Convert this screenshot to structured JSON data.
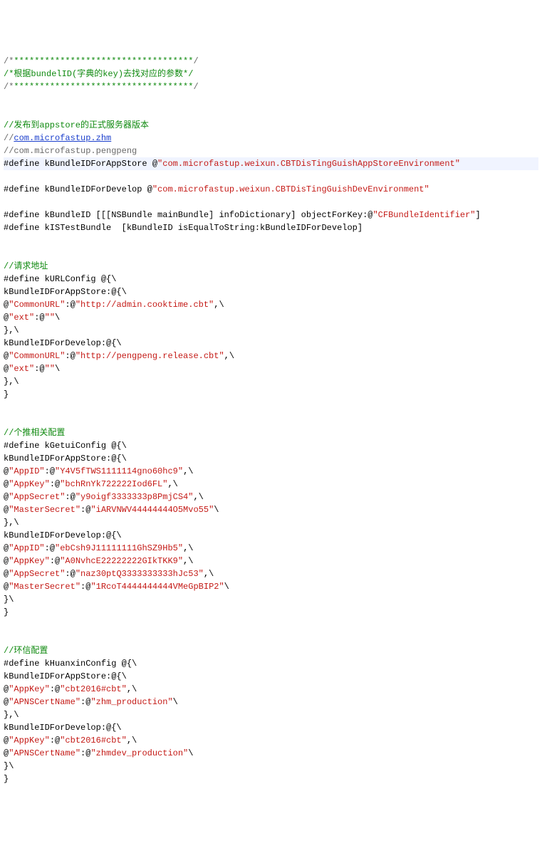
{
  "lines": [
    {
      "segs": [
        {
          "t": "/*",
          "c": "comment-gray"
        },
        {
          "t": "***********************************",
          "c": "comment-green"
        },
        {
          "t": "/",
          "c": "comment-gray"
        }
      ]
    },
    {
      "segs": [
        {
          "t": "/*根据bundelID(字典的key)去找对应的参数*/",
          "c": "comment-green"
        }
      ]
    },
    {
      "segs": [
        {
          "t": "/*",
          "c": "comment-gray"
        },
        {
          "t": "***********************************",
          "c": "comment-green"
        },
        {
          "t": "/",
          "c": "comment-gray"
        }
      ]
    },
    {
      "segs": []
    },
    {
      "segs": []
    },
    {
      "segs": [
        {
          "t": "//发布到appstore的正式服务器版本",
          "c": "comment-green"
        }
      ]
    },
    {
      "segs": [
        {
          "t": "//",
          "c": "comment-gray"
        },
        {
          "t": "com.microfastup.zhm",
          "c": "link"
        }
      ]
    },
    {
      "segs": [
        {
          "t": "//com.microfastup.pengpeng",
          "c": "comment-gray"
        }
      ]
    },
    {
      "hl": true,
      "segs": [
        {
          "t": "#define kBundleIDForAppStore @",
          "c": ""
        },
        {
          "t": "\"com.microfastup.weixun.CBTDisTingGuishAppStoreEnvironment\"",
          "c": "string-red"
        }
      ]
    },
    {
      "segs": []
    },
    {
      "segs": [
        {
          "t": "#define kBundleIDForDevelop @",
          "c": ""
        },
        {
          "t": "\"com.microfastup.weixun.CBTDisTingGuishDevEnvironment\"",
          "c": "string-red"
        }
      ]
    },
    {
      "segs": []
    },
    {
      "segs": [
        {
          "t": "#define kBundleID [[[NSBundle mainBundle] infoDictionary] objectForKey:@",
          "c": ""
        },
        {
          "t": "\"CFBundleIdentifier\"",
          "c": "string-red"
        },
        {
          "t": "]",
          "c": ""
        }
      ]
    },
    {
      "segs": [
        {
          "t": "#define kISTestBundle  [kBundleID isEqualToString:kBundleIDForDevelop]",
          "c": ""
        }
      ]
    },
    {
      "segs": []
    },
    {
      "segs": []
    },
    {
      "segs": [
        {
          "t": "//请求地址",
          "c": "comment-green"
        }
      ]
    },
    {
      "segs": [
        {
          "t": "#define kURLConfig @{\\",
          "c": ""
        }
      ]
    },
    {
      "segs": [
        {
          "t": "kBundleIDForAppStore:@{\\",
          "c": ""
        }
      ]
    },
    {
      "segs": [
        {
          "t": "@",
          "c": ""
        },
        {
          "t": "\"CommonURL\"",
          "c": "string-red"
        },
        {
          "t": ":@",
          "c": ""
        },
        {
          "t": "\"http://admin.cooktime.cbt\"",
          "c": "string-red"
        },
        {
          "t": ",\\",
          "c": ""
        }
      ]
    },
    {
      "segs": [
        {
          "t": "@",
          "c": ""
        },
        {
          "t": "\"ext\"",
          "c": "string-red"
        },
        {
          "t": ":@",
          "c": ""
        },
        {
          "t": "\"\"",
          "c": "string-red"
        },
        {
          "t": "\\",
          "c": ""
        }
      ]
    },
    {
      "segs": [
        {
          "t": "},\\",
          "c": ""
        }
      ]
    },
    {
      "segs": [
        {
          "t": "kBundleIDForDevelop:@{\\",
          "c": ""
        }
      ]
    },
    {
      "segs": [
        {
          "t": "@",
          "c": ""
        },
        {
          "t": "\"CommonURL\"",
          "c": "string-red"
        },
        {
          "t": ":@",
          "c": ""
        },
        {
          "t": "\"http://pengpeng.release.cbt\"",
          "c": "string-red"
        },
        {
          "t": ",\\",
          "c": ""
        }
      ]
    },
    {
      "segs": [
        {
          "t": "@",
          "c": ""
        },
        {
          "t": "\"ext\"",
          "c": "string-red"
        },
        {
          "t": ":@",
          "c": ""
        },
        {
          "t": "\"\"",
          "c": "string-red"
        },
        {
          "t": "\\",
          "c": ""
        }
      ]
    },
    {
      "segs": [
        {
          "t": "},\\",
          "c": ""
        }
      ]
    },
    {
      "segs": [
        {
          "t": "}",
          "c": ""
        }
      ]
    },
    {
      "segs": []
    },
    {
      "segs": []
    },
    {
      "segs": [
        {
          "t": "//个推相关配置",
          "c": "comment-green"
        }
      ]
    },
    {
      "segs": [
        {
          "t": "#define kGetuiConfig @{\\",
          "c": ""
        }
      ]
    },
    {
      "segs": [
        {
          "t": "kBundleIDForAppStore:@{\\",
          "c": ""
        }
      ]
    },
    {
      "segs": [
        {
          "t": "@",
          "c": ""
        },
        {
          "t": "\"AppID\"",
          "c": "string-red"
        },
        {
          "t": ":@",
          "c": ""
        },
        {
          "t": "\"Y4V5fTWS1111114gno60hc9\"",
          "c": "string-red"
        },
        {
          "t": ",\\",
          "c": ""
        }
      ]
    },
    {
      "segs": [
        {
          "t": "@",
          "c": ""
        },
        {
          "t": "\"AppKey\"",
          "c": "string-red"
        },
        {
          "t": ":@",
          "c": ""
        },
        {
          "t": "\"bchRnYk722222Iod6FL\"",
          "c": "string-red"
        },
        {
          "t": ",\\",
          "c": ""
        }
      ]
    },
    {
      "segs": [
        {
          "t": "@",
          "c": ""
        },
        {
          "t": "\"AppSecret\"",
          "c": "string-red"
        },
        {
          "t": ":@",
          "c": ""
        },
        {
          "t": "\"y9oigf3333333p8PmjCS4\"",
          "c": "string-red"
        },
        {
          "t": ",\\",
          "c": ""
        }
      ]
    },
    {
      "segs": [
        {
          "t": "@",
          "c": ""
        },
        {
          "t": "\"MasterSecret\"",
          "c": "string-red"
        },
        {
          "t": ":@",
          "c": ""
        },
        {
          "t": "\"iARVNWV44444444O5Mvo55\"",
          "c": "string-red"
        },
        {
          "t": "\\",
          "c": ""
        }
      ]
    },
    {
      "segs": [
        {
          "t": "},\\",
          "c": ""
        }
      ]
    },
    {
      "segs": [
        {
          "t": "kBundleIDForDevelop:@{\\",
          "c": ""
        }
      ]
    },
    {
      "segs": [
        {
          "t": "@",
          "c": ""
        },
        {
          "t": "\"AppID\"",
          "c": "string-red"
        },
        {
          "t": ":@",
          "c": ""
        },
        {
          "t": "\"ebCsh9J11111111GhSZ9Hb5\"",
          "c": "string-red"
        },
        {
          "t": ",\\",
          "c": ""
        }
      ]
    },
    {
      "segs": [
        {
          "t": "@",
          "c": ""
        },
        {
          "t": "\"AppKey\"",
          "c": "string-red"
        },
        {
          "t": ":@",
          "c": ""
        },
        {
          "t": "\"A0NvhcE22222222GIkTKK9\"",
          "c": "string-red"
        },
        {
          "t": ",\\",
          "c": ""
        }
      ]
    },
    {
      "segs": [
        {
          "t": "@",
          "c": ""
        },
        {
          "t": "\"AppSecret\"",
          "c": "string-red"
        },
        {
          "t": ":@",
          "c": ""
        },
        {
          "t": "\"naz30ptQ3333333333hJc53\"",
          "c": "string-red"
        },
        {
          "t": ",\\",
          "c": ""
        }
      ]
    },
    {
      "segs": [
        {
          "t": "@",
          "c": ""
        },
        {
          "t": "\"MasterSecret\"",
          "c": "string-red"
        },
        {
          "t": ":@",
          "c": ""
        },
        {
          "t": "\"1RcoT4444444444VMeGpBIP2\"",
          "c": "string-red"
        },
        {
          "t": "\\",
          "c": ""
        }
      ]
    },
    {
      "segs": [
        {
          "t": "}\\",
          "c": ""
        }
      ]
    },
    {
      "segs": [
        {
          "t": "}",
          "c": ""
        }
      ]
    },
    {
      "segs": []
    },
    {
      "segs": []
    },
    {
      "segs": [
        {
          "t": "//环信配置",
          "c": "comment-green"
        }
      ]
    },
    {
      "segs": [
        {
          "t": "#define kHuanxinConfig @{\\",
          "c": ""
        }
      ]
    },
    {
      "segs": [
        {
          "t": "kBundleIDForAppStore:@{\\",
          "c": ""
        }
      ]
    },
    {
      "segs": [
        {
          "t": "@",
          "c": ""
        },
        {
          "t": "\"AppKey\"",
          "c": "string-red"
        },
        {
          "t": ":@",
          "c": ""
        },
        {
          "t": "\"cbt2016#cbt\"",
          "c": "string-red"
        },
        {
          "t": ",\\",
          "c": ""
        }
      ]
    },
    {
      "segs": [
        {
          "t": "@",
          "c": ""
        },
        {
          "t": "\"APNSCertName\"",
          "c": "string-red"
        },
        {
          "t": ":@",
          "c": ""
        },
        {
          "t": "\"zhm_production\"",
          "c": "string-red"
        },
        {
          "t": "\\",
          "c": ""
        }
      ]
    },
    {
      "segs": [
        {
          "t": "},\\",
          "c": ""
        }
      ]
    },
    {
      "segs": [
        {
          "t": "kBundleIDForDevelop:@{\\",
          "c": ""
        }
      ]
    },
    {
      "segs": [
        {
          "t": "@",
          "c": ""
        },
        {
          "t": "\"AppKey\"",
          "c": "string-red"
        },
        {
          "t": ":@",
          "c": ""
        },
        {
          "t": "\"cbt2016#cbt\"",
          "c": "string-red"
        },
        {
          "t": ",\\",
          "c": ""
        }
      ]
    },
    {
      "segs": [
        {
          "t": "@",
          "c": ""
        },
        {
          "t": "\"APNSCertName\"",
          "c": "string-red"
        },
        {
          "t": ":@",
          "c": ""
        },
        {
          "t": "\"zhmdev_production\"",
          "c": "string-red"
        },
        {
          "t": "\\",
          "c": ""
        }
      ]
    },
    {
      "segs": [
        {
          "t": "}\\",
          "c": ""
        }
      ]
    },
    {
      "segs": [
        {
          "t": "}",
          "c": ""
        }
      ]
    }
  ]
}
